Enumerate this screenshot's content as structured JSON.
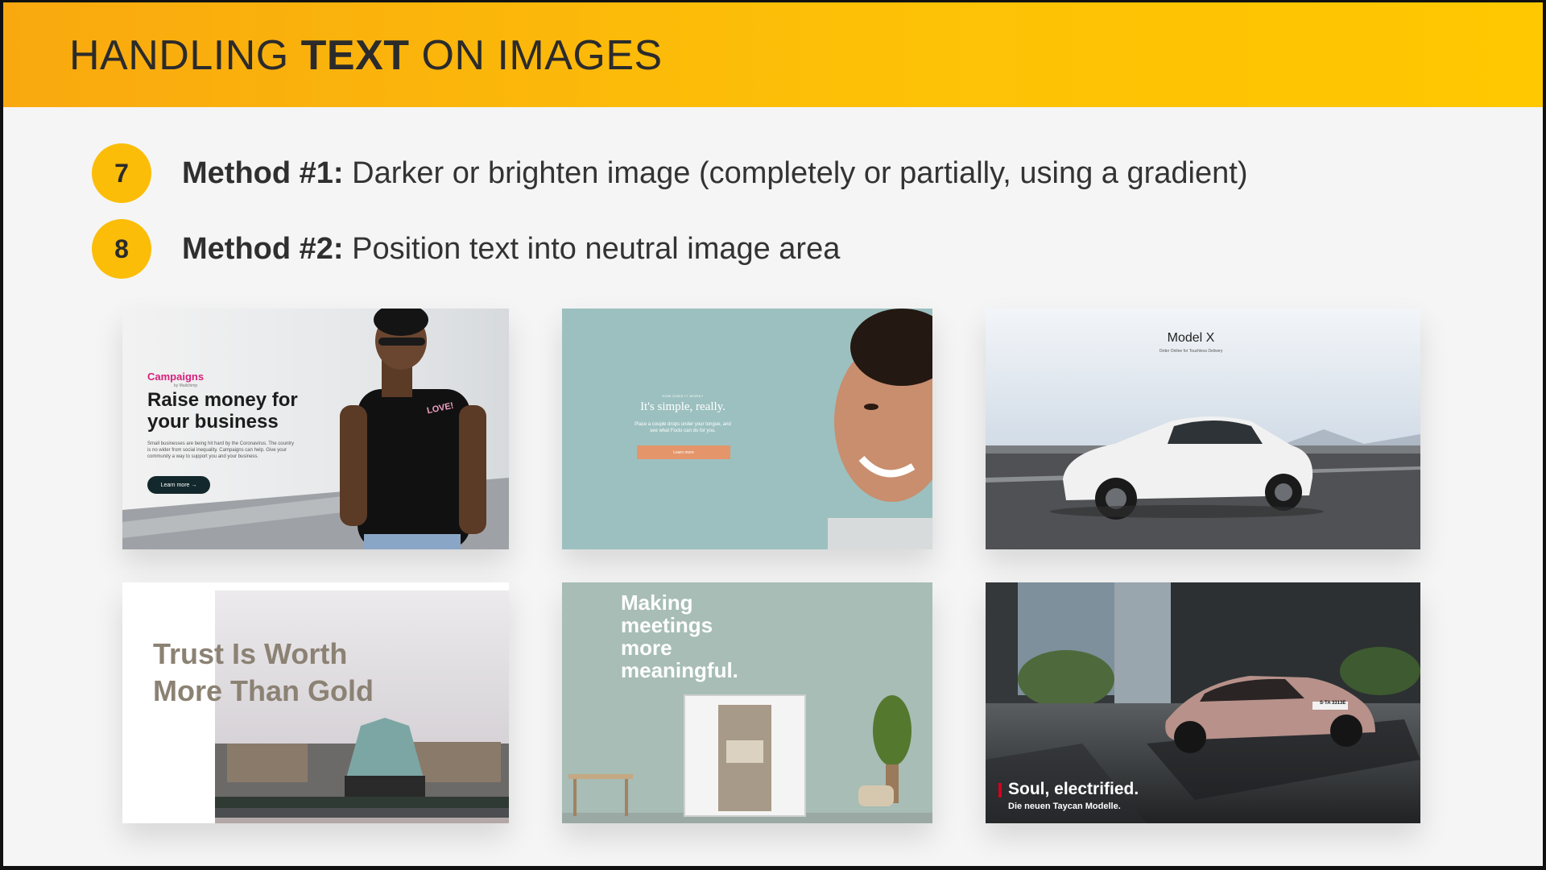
{
  "header": {
    "title_pre": "HANDLING ",
    "title_bold": "TEXT",
    "title_post": " ON IMAGES",
    "bg_colors": [
      "#f9a90f",
      "#ffc800"
    ]
  },
  "methods": [
    {
      "number": "7",
      "bold": "Method #1:",
      "text": " Darker or brighten image (completely or partially, using a gradient)"
    },
    {
      "number": "8",
      "bold": "Method #2:",
      "text": " Position text into neutral image area"
    }
  ],
  "examples": {
    "campaigns": {
      "brand": "Campaigns",
      "brand_sub": "by Mailchimp",
      "headline1": "Raise money for",
      "headline2": "your business",
      "body1": "Small businesses are being hit hard by the Coronavirus. The country",
      "body2": "is no wider from social inequality. Campaigns can help. Give your",
      "body3": "community a way to support you and your business.",
      "button": "Learn more  →",
      "shirt_text": "LOVE!"
    },
    "simple": {
      "eyebrow": "HOW DOES IT WORK?",
      "headline": "It's simple, really.",
      "body1": "Place a couple drops under your tongue, and",
      "body2": "see what Foclo can do for you.",
      "button": "Learn more"
    },
    "tesla": {
      "title": "Model X",
      "subtitle": "Order Online for Touchless Delivery"
    },
    "gold": {
      "line1": "Trust Is Worth",
      "line2": "More Than Gold"
    },
    "meetings": {
      "line1": "Making",
      "line2": "meetings",
      "line3": "more",
      "line4": "meaningful."
    },
    "porsche": {
      "headline": "Soul, electrified.",
      "sub": "Die neuen Taycan Modelle.",
      "plate": "S·TA 3313E"
    }
  }
}
